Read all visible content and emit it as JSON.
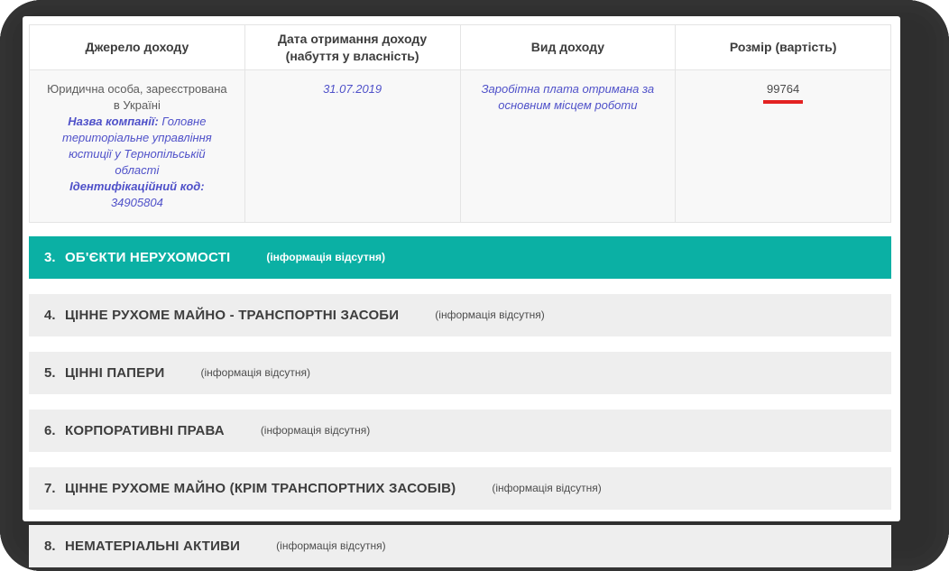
{
  "income_table": {
    "headers": {
      "source": "Джерело доходу",
      "date": "Дата отримання доходу (набуття у власність)",
      "type": "Вид доходу",
      "amount": "Розмір (вартість)"
    },
    "row": {
      "source_entity": "Юридична особа, зареєстрована в Україні",
      "company_label": "Назва компанії:",
      "company_name": "Головне територіальне управління юстиції у Тернопільській області",
      "id_code_label": "Ідентифікаційний код:",
      "id_code": "34905804",
      "date": "31.07.2019",
      "income_type": "Заробітна плата отримана за основним місцем роботи",
      "amount": "99764"
    }
  },
  "sections": [
    {
      "number": "3.",
      "title": "ОБ'ЄКТИ НЕРУХОМОСТІ",
      "note": "(інформація відсутня)",
      "highlighted": true
    },
    {
      "number": "4.",
      "title": "ЦІННЕ РУХОМЕ МАЙНО - ТРАНСПОРТНІ ЗАСОБИ",
      "note": "(інформація відсутня)",
      "highlighted": false
    },
    {
      "number": "5.",
      "title": "ЦІННІ ПАПЕРИ",
      "note": "(інформація відсутня)",
      "highlighted": false
    },
    {
      "number": "6.",
      "title": "КОРПОРАТИВНІ ПРАВА",
      "note": "(інформація відсутня)",
      "highlighted": false
    },
    {
      "number": "7.",
      "title": "ЦІННЕ РУХОМЕ МАЙНО (КРІМ ТРАНСПОРТНИХ ЗАСОБІВ)",
      "note": "(інформація відсутня)",
      "highlighted": false
    },
    {
      "number": "8.",
      "title": "НЕМАТЕРІАЛЬНІ АКТИВИ",
      "note": "(інформація відсутня)",
      "highlighted": false
    }
  ],
  "colors": {
    "accent_teal": "#0bb0a4",
    "annotation_red": "#e32222",
    "link_blue": "#4f51c9",
    "section_gray": "#eeeeee",
    "row_gray": "#f8f8f8",
    "frame_dark": "#2e2e2e"
  }
}
